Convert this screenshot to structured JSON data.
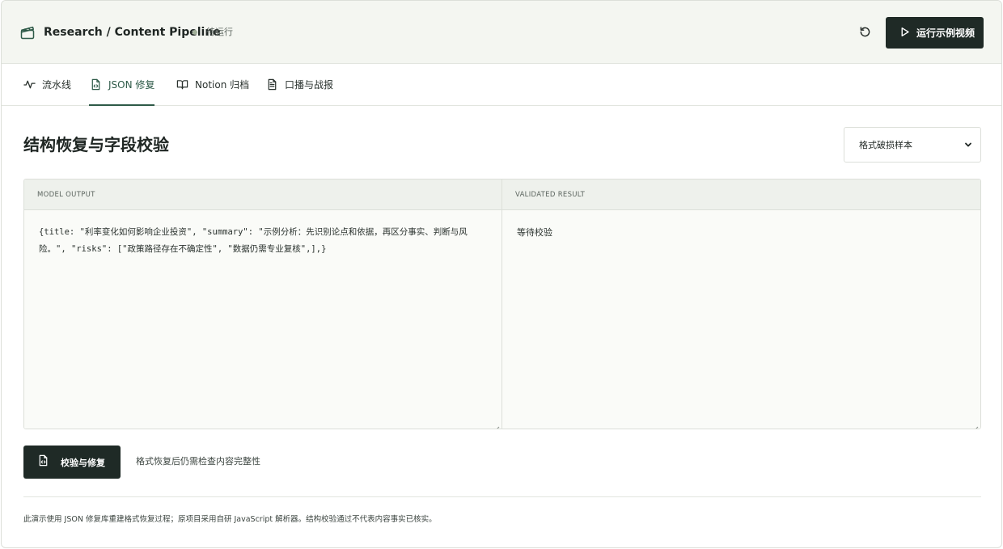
{
  "header": {
    "app_title": "Research / Content Pipeline",
    "status": "待运行",
    "run_label": "运行示例视频",
    "icons": {
      "logo": "clapperboard-icon",
      "reset": "refresh-icon",
      "run": "play-icon"
    }
  },
  "tabs": [
    {
      "label": "流水线",
      "icon": "activity-icon",
      "active": false
    },
    {
      "label": "JSON 修复",
      "icon": "file-code-icon",
      "active": true
    },
    {
      "label": "Notion 归档",
      "icon": "book-open-icon",
      "active": false
    },
    {
      "label": "口播与战报",
      "icon": "file-text-icon",
      "active": false
    }
  ],
  "main": {
    "title": "结构恢复与字段校验",
    "sample_select": {
      "value": "格式破损样本"
    },
    "panels": {
      "left": {
        "header": "MODEL OUTPUT",
        "content": "{title: \"利率变化如何影响企业投资\", \"summary\": \"示例分析：先识别论点和依据，再区分事实、判断与风险。\", \"risks\": [\"政策路径存在不确定性\", \"数据仍需专业复核\",],}"
      },
      "right": {
        "header": "VALIDATED RESULT",
        "content": "等待校验"
      }
    },
    "validate_label": "校验与修复",
    "hint": "格式恢复后仍需检查内容完整性",
    "footnote": "此演示使用 JSON 修复库重建格式恢复过程；原项目采用自研 JavaScript 解析器。结构校验通过不代表内容事实已核实。"
  },
  "colors": {
    "accent": "#2e5a48",
    "dark_button": "#1f2a26",
    "header_bg": "#f4f6f1",
    "status_dot": "#a3b19b"
  }
}
